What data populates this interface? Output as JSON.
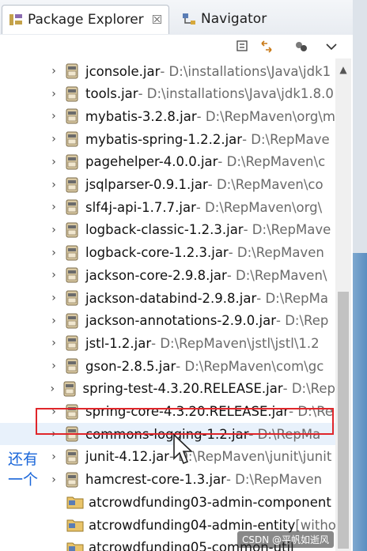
{
  "tabs": [
    {
      "label": "Package Explorer",
      "active": true,
      "icon": "package-explorer-icon",
      "close": "☒"
    },
    {
      "label": "Navigator",
      "active": false,
      "icon": "navigator-icon"
    }
  ],
  "toolbar": {
    "icons": [
      "collapse-all-icon",
      "link-with-editor-icon",
      "focus-icon",
      "view-menu-chevron-icon"
    ]
  },
  "tree": {
    "items": [
      {
        "name": "jconsole.jar",
        "path": " - D:\\installations\\Java\\jdk1",
        "type": "jar"
      },
      {
        "name": "tools.jar",
        "path": " - D:\\installations\\Java\\jdk1.8.0",
        "type": "jar"
      },
      {
        "name": "mybatis-3.2.8.jar",
        "path": " - D:\\RepMaven\\org\\m",
        "type": "jar"
      },
      {
        "name": "mybatis-spring-1.2.2.jar",
        "path": " - D:\\RepMave",
        "type": "jar"
      },
      {
        "name": "pagehelper-4.0.0.jar",
        "path": " - D:\\RepMaven\\c",
        "type": "jar"
      },
      {
        "name": "jsqlparser-0.9.1.jar",
        "path": " - D:\\RepMaven\\co",
        "type": "jar"
      },
      {
        "name": "slf4j-api-1.7.7.jar",
        "path": " - D:\\RepMaven\\org\\",
        "type": "jar"
      },
      {
        "name": "logback-classic-1.2.3.jar",
        "path": " - D:\\RepMave",
        "type": "jar"
      },
      {
        "name": "logback-core-1.2.3.jar",
        "path": " - D:\\RepMaven",
        "type": "jar"
      },
      {
        "name": "jackson-core-2.9.8.jar",
        "path": " - D:\\RepMaven\\",
        "type": "jar"
      },
      {
        "name": "jackson-databind-2.9.8.jar",
        "path": " - D:\\RepMa",
        "type": "jar"
      },
      {
        "name": "jackson-annotations-2.9.0.jar",
        "path": " - D:\\Rep",
        "type": "jar"
      },
      {
        "name": "jstl-1.2.jar",
        "path": " - D:\\RepMaven\\jstl\\jstl\\1.2",
        "type": "jar"
      },
      {
        "name": "gson-2.8.5.jar",
        "path": " - D:\\RepMaven\\com\\gc",
        "type": "jar"
      },
      {
        "name": "spring-test-4.3.20.RELEASE.jar",
        "path": " - D:\\Rep",
        "type": "jar"
      },
      {
        "name": "spring-core-4.3.20.RELEASE.jar",
        "path": " - D:\\Re",
        "type": "jar"
      },
      {
        "name": "commons-logging-1.2.jar",
        "path": " - D:\\RepMa",
        "type": "jar"
      },
      {
        "name": "junit-4.12.jar",
        "path": " - D:\\RepMaven\\junit\\junit",
        "type": "jar"
      },
      {
        "name": "hamcrest-core-1.3.jar",
        "path": " - D:\\RepMaven",
        "type": "jar"
      },
      {
        "name": "atcrowdfunding03-admin-component",
        "path": "",
        "type": "project"
      },
      {
        "name": "atcrowdfunding04-admin-entity",
        "path": " [witho",
        "type": "project"
      },
      {
        "name": "atcrowdfunding05-common-util",
        "path": "",
        "type": "project"
      }
    ]
  },
  "annotation": {
    "line1": "还有",
    "line2": "一个"
  },
  "watermark": "CSDN @平帆如逝风",
  "colors": {
    "highlight": "#e0262b",
    "annotation": "#1a66d9",
    "selection_bg": "#e8f1fb"
  }
}
